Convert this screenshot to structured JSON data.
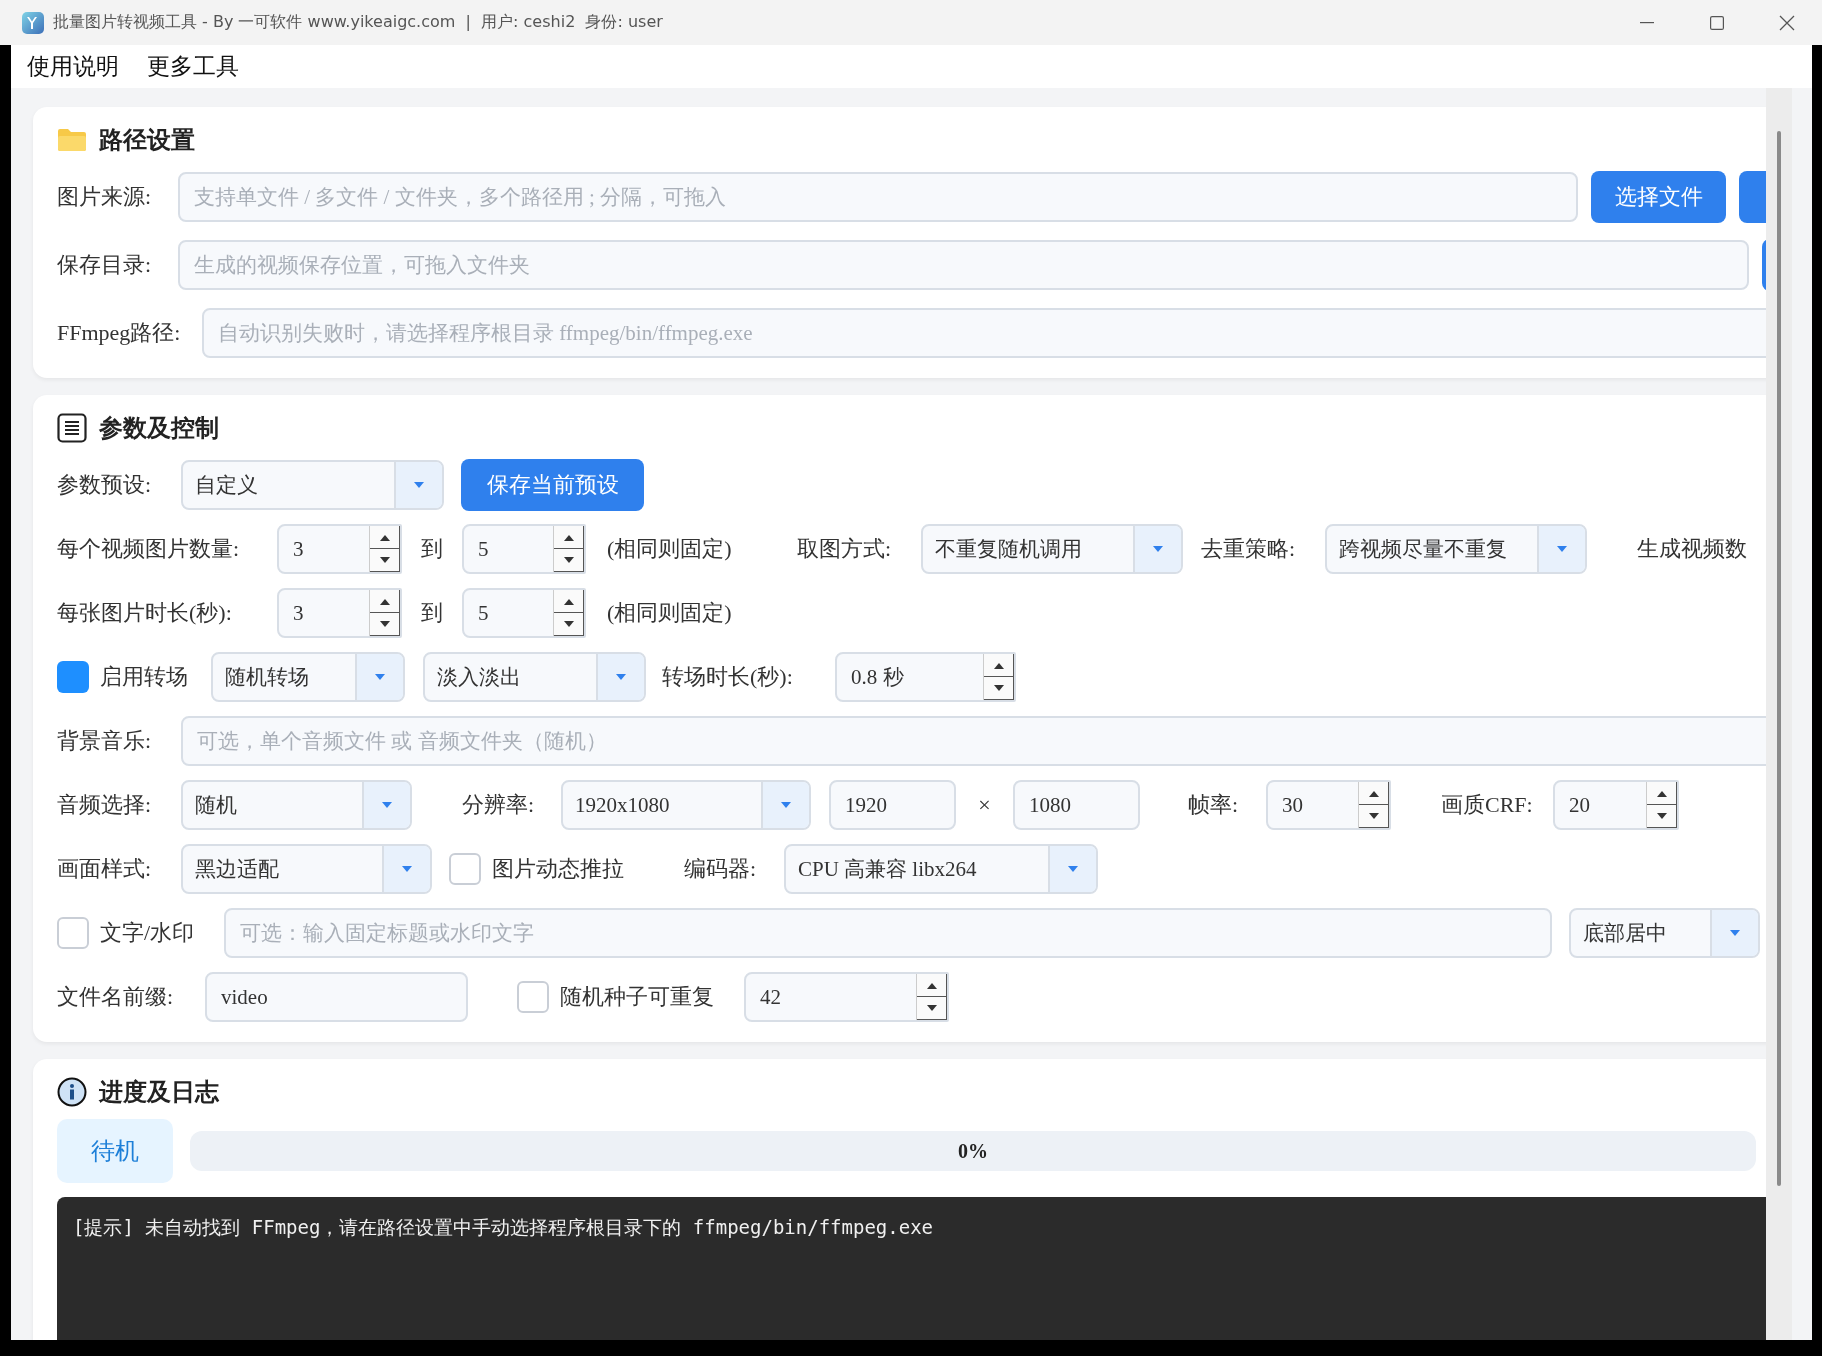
{
  "window": {
    "title": "批量图片转视频工具 - By 一可软件 www.yikeaigc.com  |  用户: ceshi2  身份: user"
  },
  "menu": [
    {
      "label": "使用说明"
    },
    {
      "label": "更多工具"
    }
  ],
  "path_card": {
    "title": "路径设置",
    "rows": [
      {
        "label": "图片来源:",
        "placeholder": "支持单文件 / 多文件 / 文件夹，多个路径用 ; 分隔，可拖入",
        "buttons": [
          {
            "kind": "text",
            "label": "选择文件"
          },
          {
            "kind": "clipped"
          }
        ]
      },
      {
        "label": "保存目录:",
        "placeholder": "生成的视频保存位置，可拖入文件夹",
        "buttons": [
          {
            "kind": "clipped"
          }
        ]
      },
      {
        "label": "FFmpeg路径:",
        "placeholder": "自动识别失败时，请选择程序根目录 ffmpeg/bin/ffmpeg.exe"
      }
    ]
  },
  "params_card": {
    "title": "参数及控制",
    "rows": [
      {
        "items": [
          {
            "kind": "label",
            "text": "参数预设:"
          },
          {
            "kind": "select",
            "value": "自定义"
          },
          {
            "kind": "button",
            "text": "保存当前预设"
          }
        ]
      },
      {
        "items": [
          {
            "kind": "label",
            "text": "每个视频图片数量:"
          },
          {
            "kind": "spin",
            "value": "3"
          },
          {
            "kind": "sep",
            "text": "到"
          },
          {
            "kind": "spin",
            "value": "5"
          },
          {
            "kind": "note",
            "text": "(相同则固定)"
          },
          {
            "kind": "label",
            "text": "取图方式:"
          },
          {
            "kind": "select",
            "value": "不重复随机调用"
          },
          {
            "kind": "label",
            "text": "去重策略:"
          },
          {
            "kind": "select",
            "value": "跨视频尽量不重复"
          },
          {
            "kind": "label",
            "text": "生成视频数"
          }
        ]
      },
      {
        "items": [
          {
            "kind": "label",
            "text": "每张图片时长(秒):"
          },
          {
            "kind": "spin",
            "value": "3"
          },
          {
            "kind": "sep",
            "text": "到"
          },
          {
            "kind": "spin",
            "value": "5"
          },
          {
            "kind": "note",
            "text": "(相同则固定)"
          }
        ]
      },
      {
        "items": [
          {
            "kind": "checkbox",
            "checked": true
          },
          {
            "kind": "label",
            "text": "启用转场"
          },
          {
            "kind": "select",
            "value": "随机转场"
          },
          {
            "kind": "select",
            "value": "淡入淡出"
          },
          {
            "kind": "label",
            "text": "转场时长(秒):"
          },
          {
            "kind": "spin",
            "value": "0.8 秒"
          }
        ]
      },
      {
        "items": [
          {
            "kind": "label",
            "text": "背景音乐:"
          },
          {
            "kind": "input",
            "placeholder": "可选，单个音频文件 或 音频文件夹（随机）"
          }
        ]
      },
      {
        "items": [
          {
            "kind": "label",
            "text": "音频选择:"
          },
          {
            "kind": "select",
            "value": "随机"
          },
          {
            "kind": "label",
            "text": "分辨率:"
          },
          {
            "kind": "select",
            "value": "1920x1080"
          },
          {
            "kind": "input",
            "value": "1920"
          },
          {
            "kind": "sep",
            "text": "×"
          },
          {
            "kind": "input",
            "value": "1080"
          },
          {
            "kind": "label",
            "text": "帧率:"
          },
          {
            "kind": "spin",
            "value": "30"
          },
          {
            "kind": "label",
            "text": "画质CRF:"
          },
          {
            "kind": "spin",
            "value": "20"
          }
        ]
      },
      {
        "items": [
          {
            "kind": "label",
            "text": "画面样式:"
          },
          {
            "kind": "select",
            "value": "黑边适配"
          },
          {
            "kind": "checkbox",
            "checked": false
          },
          {
            "kind": "label",
            "text": "图片动态推拉"
          },
          {
            "kind": "label",
            "text": "编码器:"
          },
          {
            "kind": "select",
            "value": "CPU 高兼容 libx264"
          }
        ]
      },
      {
        "items": [
          {
            "kind": "checkbox",
            "checked": false
          },
          {
            "kind": "label",
            "text": "文字/水印"
          },
          {
            "kind": "input",
            "placeholder": "可选：输入固定标题或水印文字"
          },
          {
            "kind": "select",
            "value": "底部居中"
          }
        ]
      },
      {
        "items": [
          {
            "kind": "label",
            "text": "文件名前缀:"
          },
          {
            "kind": "input",
            "value": "video"
          },
          {
            "kind": "checkbox",
            "checked": false
          },
          {
            "kind": "label",
            "text": "随机种子可重复"
          },
          {
            "kind": "spin",
            "value": "42"
          }
        ]
      }
    ]
  },
  "progress_card": {
    "title": "进度及日志",
    "status": "待机",
    "progress": {
      "level": 0,
      "text": "0%"
    },
    "log": [
      "[提示] 未自动找到 FFmpeg，请在路径设置中手动选择程序根目录下的 ffmpeg/bin/ffmpeg.exe"
    ]
  }
}
